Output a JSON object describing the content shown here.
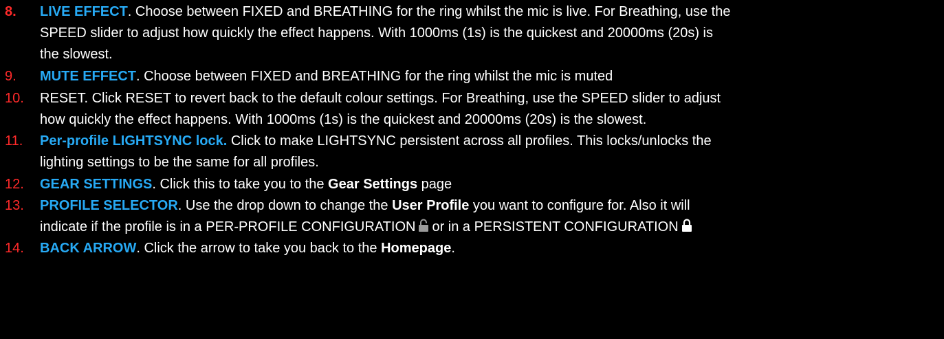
{
  "colors": {
    "number": "#ff2a2a",
    "highlight": "#27aaf5",
    "text": "#ffffff",
    "background": "#000000"
  },
  "items": [
    {
      "number": "8.",
      "term": "LIVE EFFECT",
      "line1_rest": ".  Choose between FIXED and BREATHING for the ring whilst the mic is live.  For Breathing, use the",
      "line2": "SPEED slider to adjust how quickly the effect happens.  With 1000ms (1s) is the quickest and 20000ms (20s) is",
      "line3": "the slowest."
    },
    {
      "number": "9.",
      "term": "MUTE EFFECT",
      "line1_rest": ". Choose between FIXED and BREATHING for the ring whilst the mic is muted"
    },
    {
      "number": "10.",
      "line1": "RESET.  Click RESET to revert back to the default colour settings.  For Breathing, use the SPEED slider to adjust",
      "line2": "how quickly the effect happens.  With 1000ms (1s) is the quickest and 20000ms (20s) is the slowest."
    },
    {
      "number": "11.",
      "term": "Per-profile LIGHTSYNC lock.",
      "line1_rest": "  Click to make LIGHTSYNC persistent across all profiles.  This locks/unlocks the",
      "line2": "lighting settings to be the same for all profiles."
    },
    {
      "number": "12.",
      "term": "GEAR SETTINGS",
      "line1_mid": ".  Click this to take you to the ",
      "bold_text": "Gear Settings",
      "line1_end": " page"
    },
    {
      "number": "13.",
      "term": "PROFILE SELECTOR",
      "line1_mid": ".  Use the drop down to change the ",
      "bold_text": "User Profile",
      "line1_end": " you want to configure for. Also it will",
      "line2_a": "indicate if the profile is in a PER-PROFILE CONFIGURATION",
      "icon_a": "unlocked-padlock-icon",
      "line2_b": "or in a PERSISTENT CONFIGURATION",
      "icon_b": "locked-padlock-icon"
    },
    {
      "number": "14.",
      "term": "BACK ARROW",
      "line1_mid": ".  Click the arrow to take you back to the ",
      "bold_text": "Homepage",
      "line1_end": "."
    }
  ]
}
